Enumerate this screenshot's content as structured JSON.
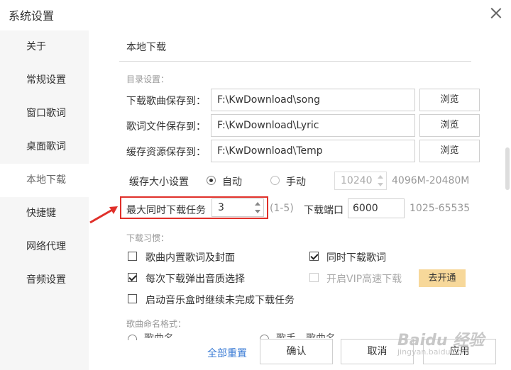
{
  "window": {
    "title": "系统设置"
  },
  "sidebar": {
    "items": [
      {
        "label": "关于"
      },
      {
        "label": "常规设置"
      },
      {
        "label": "窗口歌词"
      },
      {
        "label": "桌面歌词"
      },
      {
        "label": "本地下载",
        "active": true
      },
      {
        "label": "快捷键"
      },
      {
        "label": "网络代理"
      },
      {
        "label": "音频设置"
      }
    ]
  },
  "main": {
    "section_title": "本地下载",
    "directory": {
      "heading": "目录设置：",
      "rows": [
        {
          "label": "下载歌曲保存到：",
          "value": "F:\\KwDownload\\song",
          "button": "浏览"
        },
        {
          "label": "歌词文件保存到：",
          "value": "F:\\KwDownload\\Lyric",
          "button": "浏览"
        },
        {
          "label": "缓存资源保存到：",
          "value": "F:\\KwDownload\\Temp",
          "button": "浏览"
        }
      ]
    },
    "cache": {
      "label": "缓存大小设置",
      "auto_label": "自动",
      "manual_label": "手动",
      "selected": "自动",
      "size_value": "10240",
      "range_hint": "4096M-20480M"
    },
    "tasks": {
      "label": "最大同时下载任务",
      "value": "3",
      "range_hint": "(1-5)",
      "port_label": "下载端口",
      "port_value": "6000",
      "port_range": "1025-65535"
    },
    "habits": {
      "heading": "下载习惯：",
      "options": [
        {
          "label": "歌曲内置歌词及封面",
          "checked": false
        },
        {
          "label": "同时下载歌词",
          "checked": true
        },
        {
          "label": "每次下载弹出音质选择",
          "checked": true
        },
        {
          "label": "开启VIP高速下载",
          "checked": false,
          "disabled": true
        },
        {
          "label": "启动音乐盒时继续未完成下载任务",
          "checked": false
        }
      ],
      "vip_button": "去开通"
    },
    "naming": {
      "heading": "歌曲命名格式：",
      "option_a": "歌曲名",
      "option_b": "歌手 - 歌曲名"
    }
  },
  "footer": {
    "reset": "全部重置",
    "confirm": "确认",
    "cancel": "取消",
    "apply": "应用"
  },
  "watermark": {
    "brand": "Baidu 经验",
    "url": "jingyan.baidu.com"
  },
  "colors": {
    "accent_link": "#3a7bd5",
    "annotation_red": "#e0302a",
    "vip_button": "#f7d89a"
  }
}
